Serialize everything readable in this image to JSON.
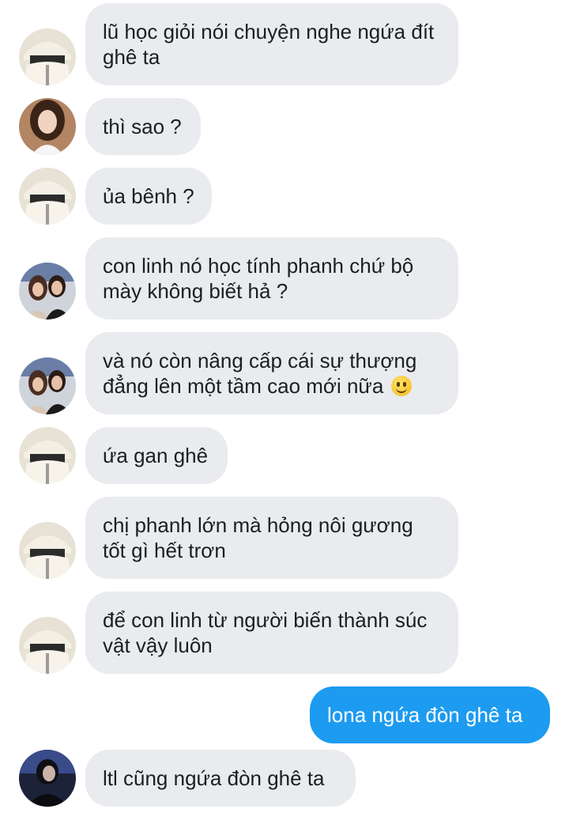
{
  "messages": [
    {
      "sender": "hat-user",
      "text": "lũ học giỏi nói chuyện nghe ngứa đít ghê ta"
    },
    {
      "sender": "girl-user",
      "text": "thì sao ?"
    },
    {
      "sender": "hat-user",
      "text": "ủa bênh ?"
    },
    {
      "sender": "duo-user",
      "text": "con linh nó học tính phanh chứ bộ mày không biết hả ?"
    },
    {
      "sender": "duo-user",
      "text": "và nó còn nâng cấp cái sự thượng đẳng lên một tầm cao mới nữa",
      "emoji": "slightly-smiling-face"
    },
    {
      "sender": "hat-user",
      "text": "ứa gan ghê"
    },
    {
      "sender": "hat-user",
      "text": "chị phanh lớn mà hỏng nôi gương tốt gì hết trơn"
    },
    {
      "sender": "hat-user",
      "text": "để con linh từ người biến thành súc vật vậy luôn"
    },
    {
      "sender": "me",
      "text": "lona ngứa đòn ghê ta"
    },
    {
      "sender": "dark-user",
      "text": "ltl cũng ngứa đòn ghê ta"
    }
  ],
  "colors": {
    "incoming_bubble": "#e9ebee",
    "outgoing_bubble": "#1d9bf0",
    "incoming_text": "#1c1e21",
    "outgoing_text": "#ffffff"
  }
}
